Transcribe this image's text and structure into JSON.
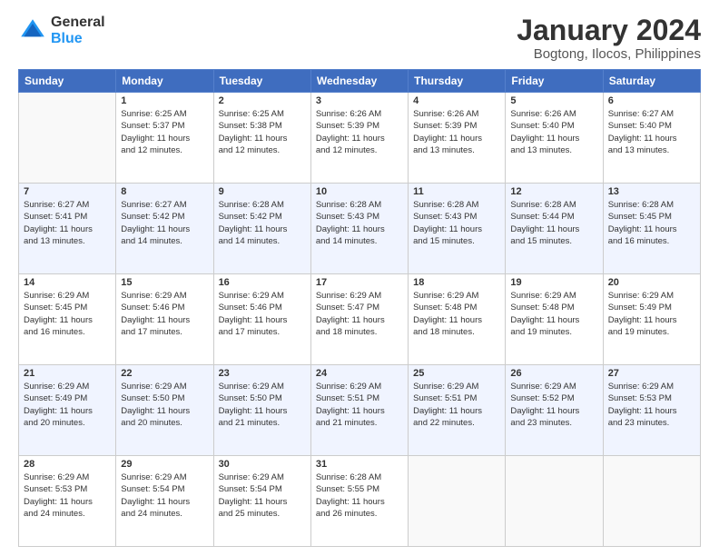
{
  "header": {
    "logo_line1": "General",
    "logo_line2": "Blue",
    "title": "January 2024",
    "subtitle": "Bogtong, Ilocos, Philippines"
  },
  "columns": [
    "Sunday",
    "Monday",
    "Tuesday",
    "Wednesday",
    "Thursday",
    "Friday",
    "Saturday"
  ],
  "weeks": [
    {
      "alt": false,
      "days": [
        {
          "num": "",
          "info": ""
        },
        {
          "num": "1",
          "info": "Sunrise: 6:25 AM\nSunset: 5:37 PM\nDaylight: 11 hours\nand 12 minutes."
        },
        {
          "num": "2",
          "info": "Sunrise: 6:25 AM\nSunset: 5:38 PM\nDaylight: 11 hours\nand 12 minutes."
        },
        {
          "num": "3",
          "info": "Sunrise: 6:26 AM\nSunset: 5:39 PM\nDaylight: 11 hours\nand 12 minutes."
        },
        {
          "num": "4",
          "info": "Sunrise: 6:26 AM\nSunset: 5:39 PM\nDaylight: 11 hours\nand 13 minutes."
        },
        {
          "num": "5",
          "info": "Sunrise: 6:26 AM\nSunset: 5:40 PM\nDaylight: 11 hours\nand 13 minutes."
        },
        {
          "num": "6",
          "info": "Sunrise: 6:27 AM\nSunset: 5:40 PM\nDaylight: 11 hours\nand 13 minutes."
        }
      ]
    },
    {
      "alt": true,
      "days": [
        {
          "num": "7",
          "info": "Sunrise: 6:27 AM\nSunset: 5:41 PM\nDaylight: 11 hours\nand 13 minutes."
        },
        {
          "num": "8",
          "info": "Sunrise: 6:27 AM\nSunset: 5:42 PM\nDaylight: 11 hours\nand 14 minutes."
        },
        {
          "num": "9",
          "info": "Sunrise: 6:28 AM\nSunset: 5:42 PM\nDaylight: 11 hours\nand 14 minutes."
        },
        {
          "num": "10",
          "info": "Sunrise: 6:28 AM\nSunset: 5:43 PM\nDaylight: 11 hours\nand 14 minutes."
        },
        {
          "num": "11",
          "info": "Sunrise: 6:28 AM\nSunset: 5:43 PM\nDaylight: 11 hours\nand 15 minutes."
        },
        {
          "num": "12",
          "info": "Sunrise: 6:28 AM\nSunset: 5:44 PM\nDaylight: 11 hours\nand 15 minutes."
        },
        {
          "num": "13",
          "info": "Sunrise: 6:28 AM\nSunset: 5:45 PM\nDaylight: 11 hours\nand 16 minutes."
        }
      ]
    },
    {
      "alt": false,
      "days": [
        {
          "num": "14",
          "info": "Sunrise: 6:29 AM\nSunset: 5:45 PM\nDaylight: 11 hours\nand 16 minutes."
        },
        {
          "num": "15",
          "info": "Sunrise: 6:29 AM\nSunset: 5:46 PM\nDaylight: 11 hours\nand 17 minutes."
        },
        {
          "num": "16",
          "info": "Sunrise: 6:29 AM\nSunset: 5:46 PM\nDaylight: 11 hours\nand 17 minutes."
        },
        {
          "num": "17",
          "info": "Sunrise: 6:29 AM\nSunset: 5:47 PM\nDaylight: 11 hours\nand 18 minutes."
        },
        {
          "num": "18",
          "info": "Sunrise: 6:29 AM\nSunset: 5:48 PM\nDaylight: 11 hours\nand 18 minutes."
        },
        {
          "num": "19",
          "info": "Sunrise: 6:29 AM\nSunset: 5:48 PM\nDaylight: 11 hours\nand 19 minutes."
        },
        {
          "num": "20",
          "info": "Sunrise: 6:29 AM\nSunset: 5:49 PM\nDaylight: 11 hours\nand 19 minutes."
        }
      ]
    },
    {
      "alt": true,
      "days": [
        {
          "num": "21",
          "info": "Sunrise: 6:29 AM\nSunset: 5:49 PM\nDaylight: 11 hours\nand 20 minutes."
        },
        {
          "num": "22",
          "info": "Sunrise: 6:29 AM\nSunset: 5:50 PM\nDaylight: 11 hours\nand 20 minutes."
        },
        {
          "num": "23",
          "info": "Sunrise: 6:29 AM\nSunset: 5:50 PM\nDaylight: 11 hours\nand 21 minutes."
        },
        {
          "num": "24",
          "info": "Sunrise: 6:29 AM\nSunset: 5:51 PM\nDaylight: 11 hours\nand 21 minutes."
        },
        {
          "num": "25",
          "info": "Sunrise: 6:29 AM\nSunset: 5:51 PM\nDaylight: 11 hours\nand 22 minutes."
        },
        {
          "num": "26",
          "info": "Sunrise: 6:29 AM\nSunset: 5:52 PM\nDaylight: 11 hours\nand 23 minutes."
        },
        {
          "num": "27",
          "info": "Sunrise: 6:29 AM\nSunset: 5:53 PM\nDaylight: 11 hours\nand 23 minutes."
        }
      ]
    },
    {
      "alt": false,
      "days": [
        {
          "num": "28",
          "info": "Sunrise: 6:29 AM\nSunset: 5:53 PM\nDaylight: 11 hours\nand 24 minutes."
        },
        {
          "num": "29",
          "info": "Sunrise: 6:29 AM\nSunset: 5:54 PM\nDaylight: 11 hours\nand 24 minutes."
        },
        {
          "num": "30",
          "info": "Sunrise: 6:29 AM\nSunset: 5:54 PM\nDaylight: 11 hours\nand 25 minutes."
        },
        {
          "num": "31",
          "info": "Sunrise: 6:28 AM\nSunset: 5:55 PM\nDaylight: 11 hours\nand 26 minutes."
        },
        {
          "num": "",
          "info": ""
        },
        {
          "num": "",
          "info": ""
        },
        {
          "num": "",
          "info": ""
        }
      ]
    }
  ]
}
